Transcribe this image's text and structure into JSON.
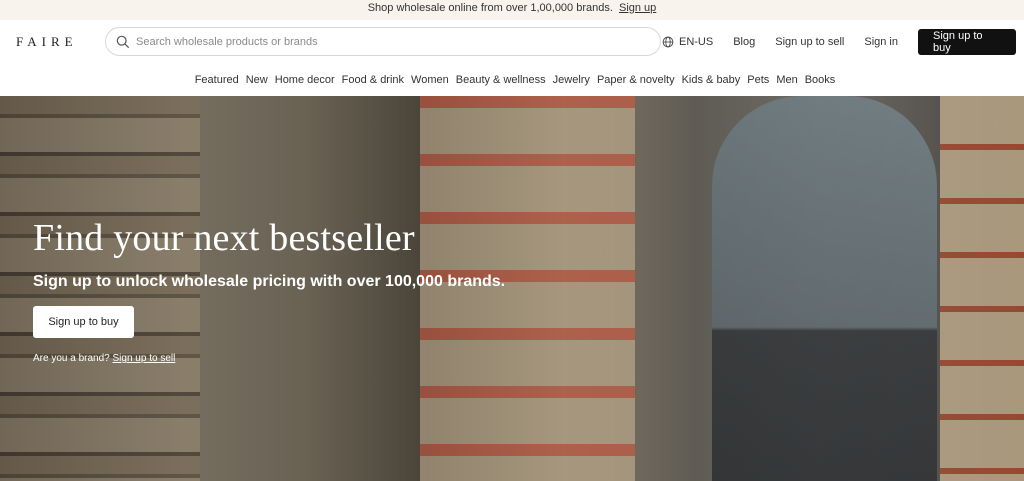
{
  "promo": {
    "text": "Shop wholesale online from over 1,00,000 brands.",
    "link": "Sign up"
  },
  "header": {
    "logo": "FAIRE",
    "search_placeholder": "Search wholesale products or brands",
    "lang": "EN-US",
    "blog": "Blog",
    "sign_up_to_sell": "Sign up to sell",
    "sign_in": "Sign in",
    "sign_up_to_buy": "Sign up to buy"
  },
  "nav": {
    "items": [
      "Featured",
      "New",
      "Home decor",
      "Food & drink",
      "Women",
      "Beauty & wellness",
      "Jewelry",
      "Paper & novelty",
      "Kids & baby",
      "Pets",
      "Men",
      "Books"
    ]
  },
  "hero": {
    "title": "Find your next bestseller",
    "subtitle": "Sign up to unlock wholesale pricing with over 100,000 brands.",
    "button": "Sign up to buy",
    "brand_question": "Are you a brand?",
    "brand_link": "Sign up to sell"
  },
  "icons": {
    "search": "search-icon",
    "globe": "globe-icon"
  }
}
